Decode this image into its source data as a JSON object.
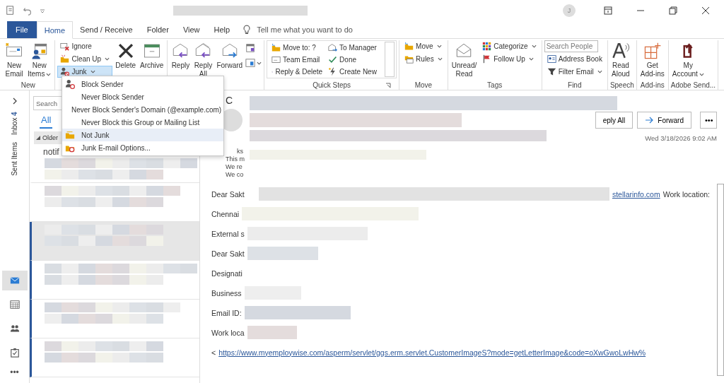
{
  "title_bar": {
    "avatar": "J"
  },
  "tabs": [
    {
      "label": "File",
      "kind": "file",
      "selected": false
    },
    {
      "label": "Home",
      "kind": "tab",
      "selected": true
    },
    {
      "label": "Send / Receive",
      "kind": "tab",
      "selected": false
    },
    {
      "label": "Folder",
      "kind": "tab",
      "selected": false
    },
    {
      "label": "View",
      "kind": "tab",
      "selected": false
    },
    {
      "label": "Help",
      "kind": "tab",
      "selected": false
    }
  ],
  "tell_me": {
    "placeholder": "Tell me what you want to do"
  },
  "ribbon": {
    "groups": [
      {
        "label": "New",
        "items": [
          {
            "kind": "large",
            "label": "New\nEmail",
            "dropdown": false
          },
          {
            "kind": "large",
            "label": "New\nItems",
            "dropdown": true
          }
        ]
      },
      {
        "items": [
          {
            "kind": "stack",
            "rows": [
              {
                "label": "Ignore",
                "dropdown": false,
                "pressed": false
              },
              {
                "label": "Clean Up",
                "dropdown": true,
                "pressed": false
              },
              {
                "label": "Junk",
                "dropdown": true,
                "pressed": true
              }
            ]
          },
          {
            "kind": "large",
            "label": "Delete",
            "dropdown": false
          },
          {
            "kind": "large",
            "label": "Archive",
            "dropdown": false
          }
        ]
      },
      {
        "items": [
          {
            "kind": "large",
            "label": "Reply",
            "dropdown": false
          },
          {
            "kind": "large",
            "label": "Reply\nAll",
            "dropdown": false
          },
          {
            "kind": "large",
            "label": "Forward",
            "dropdown": false
          },
          {
            "kind": "icon-stack"
          }
        ]
      },
      {
        "label": "Quick Steps",
        "items": [
          {
            "kind": "gallery",
            "columns": [
              [
                "Move to: ?",
                "Team Email",
                "Reply & Delete"
              ],
              [
                "To Manager",
                "Done",
                "Create New"
              ]
            ]
          }
        ]
      },
      {
        "label": "Move",
        "items": [
          {
            "kind": "stack",
            "rows": [
              {
                "label": "Move",
                "dropdown": true
              },
              {
                "label": "Rules",
                "dropdown": true
              }
            ]
          }
        ]
      },
      {
        "label": "Tags",
        "items": [
          {
            "kind": "large",
            "label": "Unread/\nRead",
            "dropdown": false
          },
          {
            "kind": "stack",
            "rows": [
              {
                "label": "Categorize",
                "dropdown": true
              },
              {
                "label": "Follow Up",
                "dropdown": true
              }
            ]
          }
        ]
      },
      {
        "label": "Find",
        "items": [
          {
            "kind": "stack",
            "rows": [
              {
                "kind": "field",
                "placeholder": "Search People"
              },
              {
                "kind": "button",
                "label": "Address Book",
                "dropdown": false
              },
              {
                "kind": "button",
                "label": "Filter Email",
                "dropdown": true
              }
            ]
          }
        ]
      },
      {
        "label": "Speech",
        "items": [
          {
            "kind": "large",
            "label": "Read\nAloud",
            "dropdown": false
          }
        ]
      },
      {
        "label": "Add-ins",
        "items": [
          {
            "kind": "large",
            "label": "Get\nAdd-ins",
            "dropdown": false
          }
        ]
      },
      {
        "label": "Adobe Send...",
        "items": [
          {
            "kind": "large",
            "label": "My\nAccount",
            "dropdown": true
          }
        ]
      }
    ]
  },
  "junk_menu": {
    "items": [
      {
        "label": "Block Sender",
        "highlighted": false
      },
      {
        "label": "Never Block Sender",
        "highlighted": false
      },
      {
        "label": "Never Block Sender's Domain (@example.com)",
        "highlighted": false
      },
      {
        "label": "Never Block this Group or Mailing List",
        "highlighted": false
      },
      {
        "label": "Not Junk",
        "highlighted": true
      },
      {
        "label": "Junk E-mail Options...",
        "highlighted": false
      }
    ]
  },
  "nav_rail": {
    "folders": [
      {
        "label": "Inbox",
        "count": "4"
      },
      {
        "label": "Sent Items"
      }
    ],
    "apps": [
      {
        "selected": true
      },
      {
        "selected": false
      },
      {
        "selected": false
      },
      {
        "selected": false
      }
    ],
    "more": "•••"
  },
  "message_list": {
    "search": {
      "placeholder": "Search"
    },
    "filters": [
      {
        "label": "All",
        "selected": true
      }
    ],
    "group_header": "Older",
    "messages": [
      {
        "sender": "notif",
        "unread": false,
        "selected": false
      },
      {
        "unread": false,
        "selected": false
      },
      {
        "unread": true,
        "selected": true
      },
      {
        "unread": true,
        "selected": false
      },
      {
        "unread": true,
        "selected": false
      },
      {
        "unread": true,
        "selected": false
      }
    ]
  },
  "reading_pane": {
    "subject": "C",
    "actions": [
      {
        "label": "eply All"
      },
      {
        "label": "Forward"
      }
    ],
    "more": "•••",
    "date": "Wed 3/18/2026 9:02 AM",
    "preview_lines": [
      "ks",
      "This m",
      "We re",
      "We co"
    ],
    "body": [
      {
        "text": "Dear Sakt",
        "link": "stellarinfo.com",
        "after": "Work location:"
      },
      {
        "text": "Chennai"
      },
      {
        "text": "External s"
      },
      {
        "text": "Dear Sakt"
      },
      {
        "text": "Designati"
      },
      {
        "text": "Business"
      },
      {
        "text": "Email ID:"
      },
      {
        "text": "Work loca"
      },
      {
        "text": "<",
        "link": "https://www.myemploywise.com/asperm/servlet/ggs.erm.servlet.CustomerImageS?mode=getLetterImage&code=oXwGwoLwHw%"
      }
    ]
  }
}
